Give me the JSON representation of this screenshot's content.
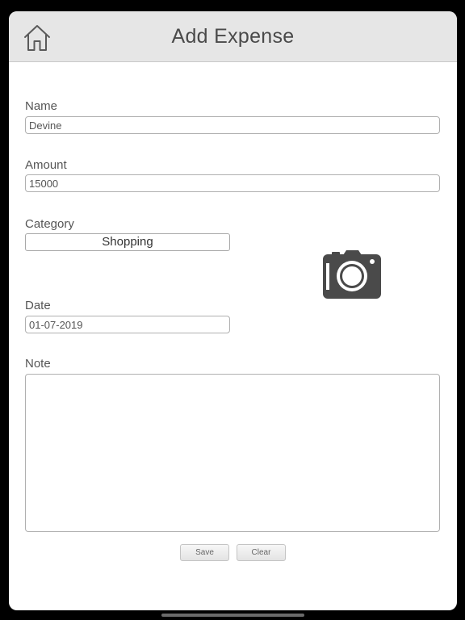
{
  "header": {
    "title": "Add Expense",
    "home_icon": "home-icon"
  },
  "form": {
    "name_label": "Name",
    "name_value": "Devine",
    "amount_label": "Amount",
    "amount_value": "15000",
    "category_label": "Category",
    "category_value": "Shopping",
    "date_label": "Date",
    "date_value": "01-07-2019",
    "note_label": "Note",
    "note_value": "",
    "camera_icon": "camera-icon"
  },
  "actions": {
    "save_label": "Save",
    "clear_label": "Clear"
  }
}
